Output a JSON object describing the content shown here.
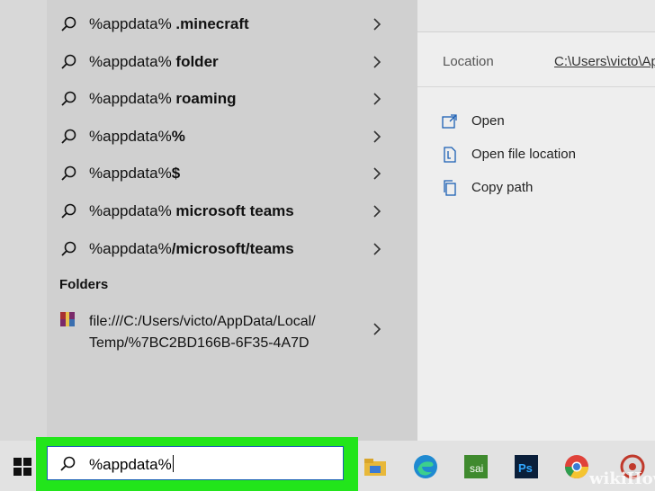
{
  "search_results": {
    "suggestions": [
      {
        "prefix": "%appdata%",
        "suffix": " .minecraft"
      },
      {
        "prefix": "%appdata%",
        "suffix": " folder"
      },
      {
        "prefix": "%appdata%",
        "suffix": " roaming"
      },
      {
        "prefix": "%appdata%",
        "suffix": "%"
      },
      {
        "prefix": "%appdata%",
        "suffix": "$"
      },
      {
        "prefix": "%appdata%",
        "suffix": " microsoft teams"
      },
      {
        "prefix": "%appdata%",
        "suffix": "/microsoft/teams"
      }
    ],
    "folders_heading": "Folders",
    "folder_item": {
      "line1": "file:///C:/Users/victo/AppData/Local/",
      "line2": "Temp/%7BC2BD166B-6F35-4A7D"
    }
  },
  "details": {
    "location_label": "Location",
    "location_path": "C:\\Users\\victo\\Ap",
    "actions": [
      "Open",
      "Open file location",
      "Copy path"
    ]
  },
  "taskbar": {
    "search_text": "%appdata%",
    "apps": [
      "file-explorer-icon",
      "edge-icon",
      "sai-icon",
      "photoshop-icon",
      "chrome-icon",
      "app-icon"
    ]
  },
  "watermark": {
    "wiki": "wiki",
    "how": "How"
  },
  "colors": {
    "highlight": "#22e51b",
    "accent": "#1a5fb4"
  }
}
